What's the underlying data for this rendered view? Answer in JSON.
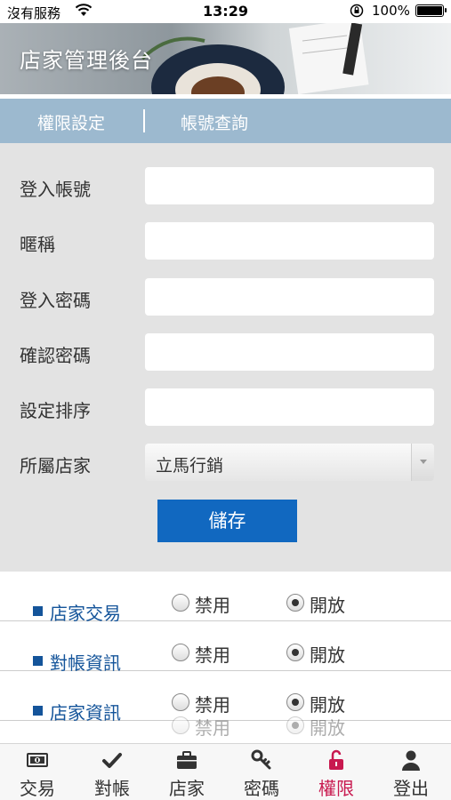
{
  "status_bar": {
    "carrier": "沒有服務",
    "time": "13:29",
    "battery": "100%"
  },
  "header": {
    "title": "店家管理後台"
  },
  "tabs": [
    {
      "label": "權限設定"
    },
    {
      "label": "帳號查詢"
    }
  ],
  "form": {
    "fields": [
      {
        "label": "登入帳號",
        "value": ""
      },
      {
        "label": "暱稱",
        "value": ""
      },
      {
        "label": "登入密碼",
        "value": ""
      },
      {
        "label": "確認密碼",
        "value": ""
      },
      {
        "label": "設定排序",
        "value": ""
      }
    ],
    "store": {
      "label": "所屬店家",
      "selected": "立馬行銷"
    },
    "save_label": "儲存"
  },
  "permissions": {
    "disable_label": "禁用",
    "open_label": "開放",
    "rows": [
      {
        "name": "店家交易",
        "selected": "open"
      },
      {
        "name": "對帳資訊",
        "selected": "open"
      },
      {
        "name": "店家資訊",
        "selected": "open"
      }
    ]
  },
  "tabbar": {
    "items": [
      {
        "label": "交易",
        "icon": "money-icon"
      },
      {
        "label": "對帳",
        "icon": "checkmark-icon"
      },
      {
        "label": "店家",
        "icon": "briefcase-icon"
      },
      {
        "label": "密碼",
        "icon": "key-icon"
      },
      {
        "label": "權限",
        "icon": "unlock-icon"
      },
      {
        "label": "登出",
        "icon": "user-icon"
      }
    ],
    "active_index": 4,
    "active_color": "#c8194f"
  },
  "colors": {
    "accent": "#1168c0",
    "tabs_bg": "#9cb9cf",
    "permission_text": "#14549a"
  }
}
